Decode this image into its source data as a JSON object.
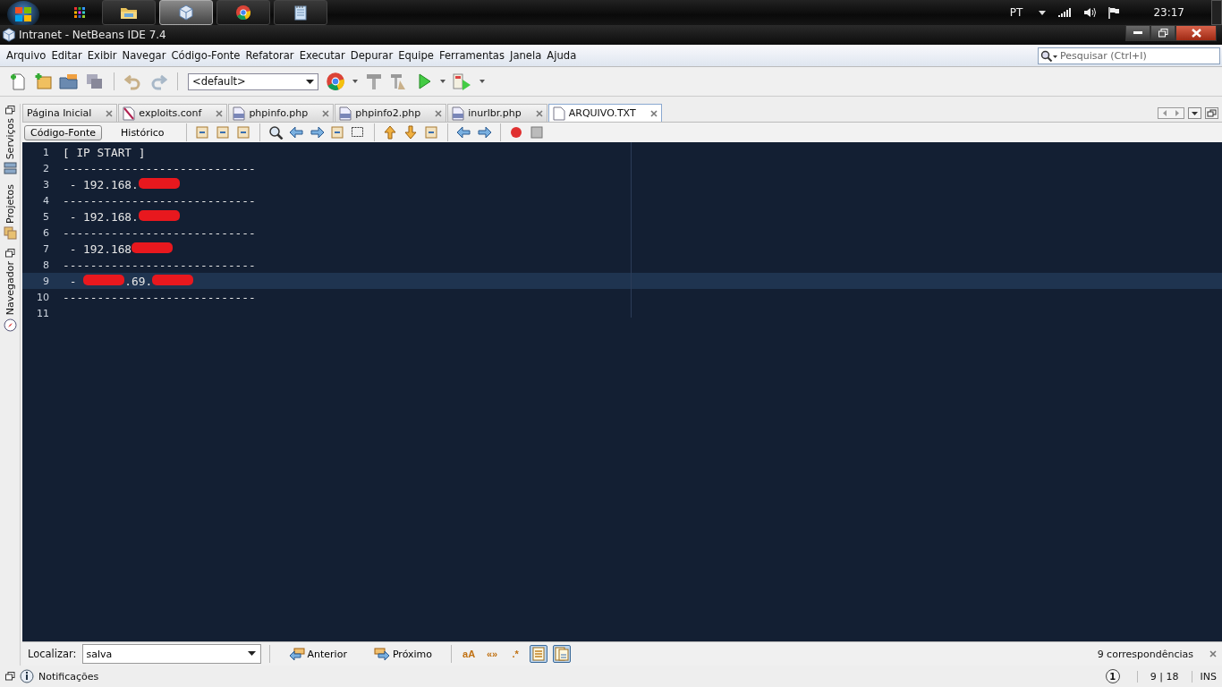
{
  "taskbar": {
    "tasks": [
      {
        "kind": "grid",
        "active": false
      },
      {
        "kind": "folder",
        "active": false
      },
      {
        "kind": "cube",
        "active": true
      },
      {
        "kind": "browser",
        "active": false
      },
      {
        "kind": "notepad",
        "active": false
      }
    ],
    "language": "PT",
    "clock": "23:17"
  },
  "window": {
    "title": "Intranet - NetBeans IDE 7.4"
  },
  "menu": [
    "Arquivo",
    "Editar",
    "Exibir",
    "Navegar",
    "Código-Fonte",
    "Refatorar",
    "Executar",
    "Depurar",
    "Equipe",
    "Ferramentas",
    "Janela",
    "Ajuda"
  ],
  "search": {
    "placeholder": "Pesquisar (Ctrl+I)"
  },
  "toolbar": {
    "configuration": "<default>"
  },
  "side_panels": [
    {
      "label": "Serviços"
    },
    {
      "label": "Projetos"
    },
    {
      "label": "Navegador"
    }
  ],
  "editor_tabs": [
    {
      "label": "Página Inicial",
      "kind": "home",
      "selected": false
    },
    {
      "label": "exploits.conf",
      "kind": "conf",
      "selected": false
    },
    {
      "label": "phpinfo.php",
      "kind": "php",
      "selected": false
    },
    {
      "label": "phpinfo2.php",
      "kind": "php",
      "selected": false
    },
    {
      "label": "inurlbr.php",
      "kind": "php",
      "selected": false
    },
    {
      "label": "ARQUIVO.TXT",
      "kind": "text",
      "selected": true
    }
  ],
  "view_tabs": [
    {
      "label": "Código-Fonte",
      "selected": true
    },
    {
      "label": "Histórico",
      "selected": false
    }
  ],
  "lines": [
    {
      "number": "1",
      "current": false,
      "segments": [
        {
          "kind": "text",
          "text": "[ IP START ]"
        }
      ]
    },
    {
      "number": "2",
      "current": false,
      "segments": [
        {
          "kind": "text",
          "text": "----------------------------"
        }
      ]
    },
    {
      "number": "3",
      "current": false,
      "segments": [
        {
          "kind": "text",
          "text": " - 192.168."
        },
        {
          "kind": "redacted"
        }
      ]
    },
    {
      "number": "4",
      "current": false,
      "segments": [
        {
          "kind": "text",
          "text": "----------------------------"
        }
      ]
    },
    {
      "number": "5",
      "current": false,
      "segments": [
        {
          "kind": "text",
          "text": " - 192.168."
        },
        {
          "kind": "redacted"
        }
      ]
    },
    {
      "number": "6",
      "current": false,
      "segments": [
        {
          "kind": "text",
          "text": "----------------------------"
        }
      ]
    },
    {
      "number": "7",
      "current": false,
      "segments": [
        {
          "kind": "text",
          "text": " - 192.168"
        },
        {
          "kind": "redacted"
        }
      ]
    },
    {
      "number": "8",
      "current": false,
      "segments": [
        {
          "kind": "text",
          "text": "----------------------------"
        }
      ]
    },
    {
      "number": "9",
      "current": true,
      "segments": [
        {
          "kind": "text",
          "text": " - "
        },
        {
          "kind": "redacted"
        },
        {
          "kind": "text",
          "text": ".69."
        },
        {
          "kind": "redacted"
        }
      ]
    },
    {
      "number": "10",
      "current": false,
      "segments": [
        {
          "kind": "text",
          "text": "----------------------------"
        }
      ]
    },
    {
      "number": "11",
      "current": false
    }
  ],
  "find_bar": {
    "label": "Localizar:",
    "value": "salva",
    "previous": "Anterior",
    "next": "Próximo",
    "options": [
      {
        "kind": "glyph",
        "glyph": "aA",
        "selected": false
      },
      {
        "kind": "glyph",
        "glyph": "«»",
        "selected": false
      },
      {
        "kind": "glyph",
        "glyph": ".*",
        "selected": false
      },
      {
        "kind": "highlight",
        "selected": true
      },
      {
        "kind": "wrap",
        "selected": true
      }
    ],
    "result": "9 correspondências"
  },
  "status_bar": {
    "notifications": "Notificações",
    "badge": "1",
    "position": "9 | 18",
    "mode": "INS"
  }
}
